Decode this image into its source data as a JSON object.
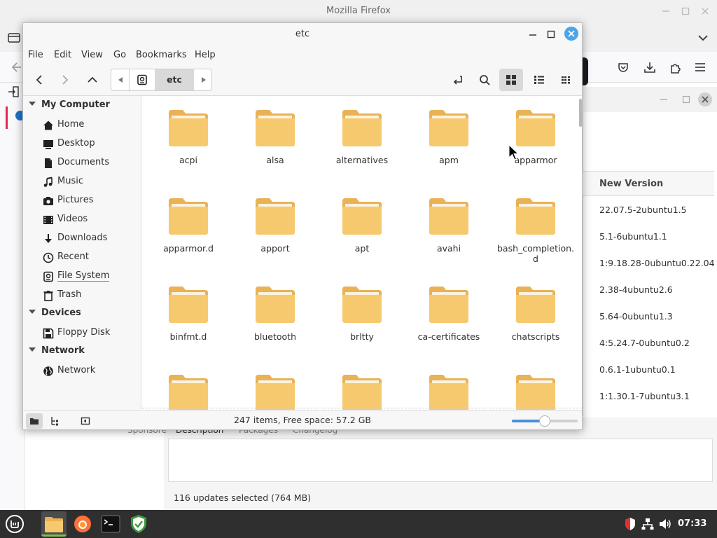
{
  "firefox": {
    "title": "Mozilla Firefox"
  },
  "update_manager": {
    "column_header": "New Version",
    "versions": [
      "22.07.5-2ubuntu1.5",
      "5.1-6ubuntu1.1",
      "1:9.18.28-0ubuntu0.22.04.",
      "2.38-4ubuntu2.6",
      "5.64-0ubuntu1.3",
      "4:5.24.7-0ubuntu0.2",
      "0.6.1-1ubuntu0.1",
      "1:1.30.1-7ubuntu3.1"
    ],
    "tabs": {
      "sponsored": "Sponsore",
      "description": "Description",
      "packages": "Packages",
      "changelog": "Changelog"
    },
    "status": "116 updates selected (764 MB)"
  },
  "nemo": {
    "title": "etc",
    "menu": [
      "File",
      "Edit",
      "View",
      "Go",
      "Bookmarks",
      "Help"
    ],
    "path_current": "etc",
    "sidebar": {
      "my_computer": {
        "heading": "My Computer",
        "items": [
          "Home",
          "Desktop",
          "Documents",
          "Music",
          "Pictures",
          "Videos",
          "Downloads",
          "Recent",
          "File System",
          "Trash"
        ]
      },
      "devices": {
        "heading": "Devices",
        "items": [
          "Floppy Disk"
        ]
      },
      "network": {
        "heading": "Network",
        "items": [
          "Network"
        ]
      }
    },
    "folders": [
      "acpi",
      "alsa",
      "alternatives",
      "apm",
      "apparmor",
      "apparmor.d",
      "apport",
      "apt",
      "avahi",
      "bash_completion.d",
      "binfmt.d",
      "bluetooth",
      "brltty",
      "ca-certificates",
      "chatscripts",
      "",
      "",
      "",
      "",
      ""
    ],
    "status": "247 items, Free space: 57.2 GB",
    "zoom_level": 0.5
  },
  "taskbar": {
    "clock": "07:33"
  },
  "colors": {
    "folder_body": "#f5c46b",
    "folder_tab": "#e9b254",
    "accent": "#4a90d9",
    "close_button": "#4aa6e9"
  }
}
